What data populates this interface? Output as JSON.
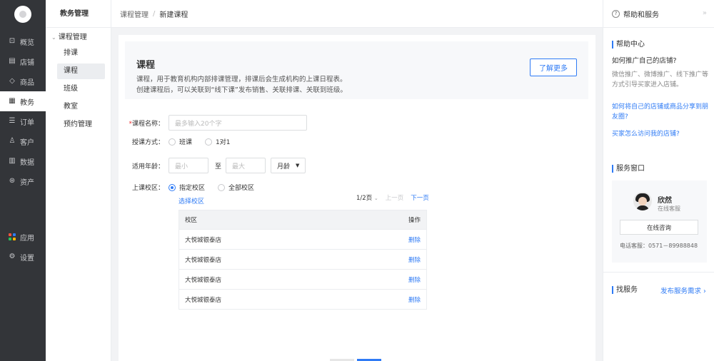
{
  "nav": {
    "logo": "logo-icon",
    "items": [
      {
        "label": "概览",
        "icon": "overview-icon",
        "glyph": "⊡"
      },
      {
        "label": "店铺",
        "icon": "store-icon",
        "glyph": "▤"
      },
      {
        "label": "商品",
        "icon": "tag-icon",
        "glyph": "◇"
      },
      {
        "label": "教务",
        "icon": "education-icon",
        "glyph": "▦"
      },
      {
        "label": "订单",
        "icon": "order-icon",
        "glyph": "☰"
      },
      {
        "label": "客户",
        "icon": "customer-icon",
        "glyph": "♙"
      },
      {
        "label": "数据",
        "icon": "data-icon",
        "glyph": "▥"
      },
      {
        "label": "资产",
        "icon": "asset-icon",
        "glyph": "⊛"
      }
    ],
    "bottom_items": [
      {
        "label": "应用",
        "icon": "apps-icon",
        "glyph": "■"
      },
      {
        "label": "设置",
        "icon": "settings-icon",
        "glyph": "⚙"
      }
    ],
    "active_index": 3
  },
  "submenu": {
    "title": "教务管理",
    "group": "课程管理",
    "items": [
      "排课",
      "课程",
      "班级",
      "教室",
      "预约管理"
    ],
    "active_index": 1
  },
  "breadcrumb": {
    "parent": "课程管理",
    "separator": "/",
    "current": "新建课程"
  },
  "intro": {
    "title": "课程",
    "line1": "课程，用于教育机构内部排课管理，排课后会生成机构的上课日程表。",
    "line2": "创建课程后，可以关联到“线下课”发布销售、关联排课、关联到班级。",
    "button": "了解更多"
  },
  "form": {
    "name_label": "课程名称：",
    "name_placeholder": "最多输入20个字",
    "mode_label": "授课方式：",
    "mode_options": [
      "班课",
      "1对1"
    ],
    "age_label": "适用年龄：",
    "age_min_placeholder": "最小",
    "age_to": "至",
    "age_max_placeholder": "最大",
    "age_unit": "月龄",
    "campus_label": "上课校区：",
    "campus_options": [
      "指定校区",
      "全部校区"
    ],
    "campus_selected": 0,
    "select_campus_link": "选择校区"
  },
  "pager": {
    "current": "1/2页",
    "prev": "上一页",
    "next": "下一页"
  },
  "table": {
    "col_campus": "校区",
    "col_action": "操作",
    "rows": [
      {
        "campus": "大悦城银泰店",
        "action": "删除"
      },
      {
        "campus": "大悦城银泰店",
        "action": "删除"
      },
      {
        "campus": "大悦城银泰店",
        "action": "删除"
      },
      {
        "campus": "大悦城银泰店",
        "action": "删除"
      }
    ]
  },
  "help": {
    "title": "帮助和服务",
    "center_title": "帮助中心",
    "q1": "如何推广自己的店铺?",
    "a1": "微信推广、微博推广、线下推广等方式引导买家进入店铺。",
    "link1": "如何将自己的店铺或商品分享到朋友圈?",
    "link2": "买家怎么访问我的店铺?",
    "service_title": "服务窗口",
    "agent_name": "欣然",
    "agent_status": "在线客服",
    "consult_button": "在线咨询",
    "phone": "电话客服：0571－89988848",
    "find_title": "找服务",
    "find_link": "发布服务需求 ›"
  },
  "colors": {
    "accent": "#2f7bf5",
    "nav_bg": "#333539",
    "apps_icon": [
      "#f5533d",
      "#2f7bf5",
      "#27c25a",
      "#ffb400"
    ]
  }
}
